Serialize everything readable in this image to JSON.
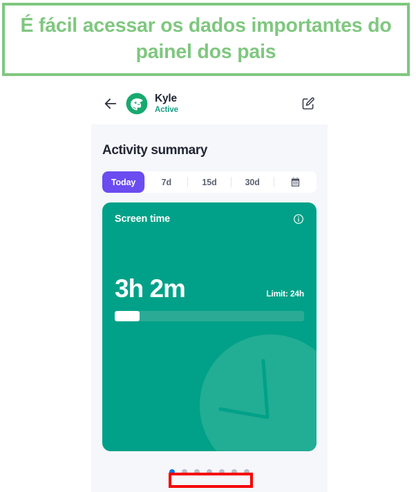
{
  "banner": {
    "text": "É fácil acessar os dados importantes do painel dos pais",
    "border_color": "#7fc77f",
    "text_color": "#7fc77f"
  },
  "app": {
    "header": {
      "back_icon": "back-arrow-icon",
      "avatar_icon": "child-avatar-whale",
      "child_name": "Kyle",
      "child_status": "Active",
      "edit_icon": "edit-pencil-icon"
    },
    "section_title": "Activity summary",
    "tabs": [
      {
        "label": "Today",
        "active": true
      },
      {
        "label": "7d",
        "active": false
      },
      {
        "label": "15d",
        "active": false
      },
      {
        "label": "30d",
        "active": false
      }
    ],
    "calendar_icon": "calendar-icon",
    "card": {
      "title": "Screen time",
      "info_icon": "info-circle-icon",
      "value": "3h 2m",
      "limit_label": "Limit: 24h",
      "progress_percent": 13,
      "background_color": "#00a188",
      "decoration_icon": "clock-icon"
    },
    "pagination": {
      "total": 7,
      "active_index": 0,
      "active_color": "#1173e6",
      "inactive_color": "#b9bcc6"
    }
  },
  "annotation": {
    "highlight_color": "#f50000",
    "target": "pagination-dots"
  },
  "theme": {
    "accent_purple": "#6b4cf0",
    "accent_teal": "#00a188",
    "status_green": "#16a085"
  }
}
